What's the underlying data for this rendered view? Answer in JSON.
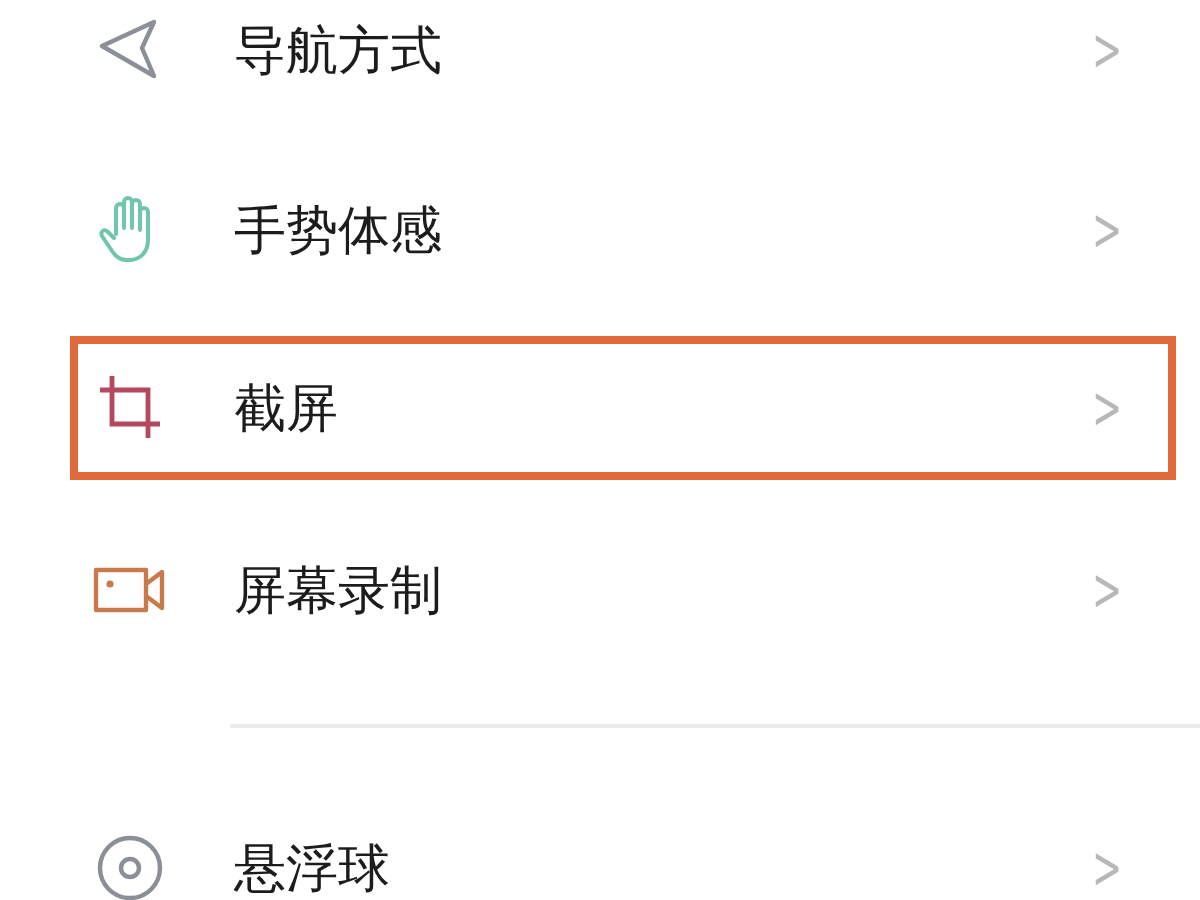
{
  "groups": [
    {
      "items": [
        {
          "kind": "navigation",
          "label": "导航方式",
          "chevron": ">",
          "highlighted": false
        },
        {
          "kind": "gesture",
          "label": "手势体感",
          "chevron": ">",
          "highlighted": false
        },
        {
          "kind": "screenshot",
          "label": "截屏",
          "chevron": ">",
          "highlighted": true
        },
        {
          "kind": "recording",
          "label": "屏幕录制",
          "chevron": ">",
          "highlighted": false
        }
      ]
    },
    {
      "items": [
        {
          "kind": "floating-ball",
          "label": "悬浮球",
          "chevron": ">",
          "highlighted": false
        }
      ]
    }
  ]
}
